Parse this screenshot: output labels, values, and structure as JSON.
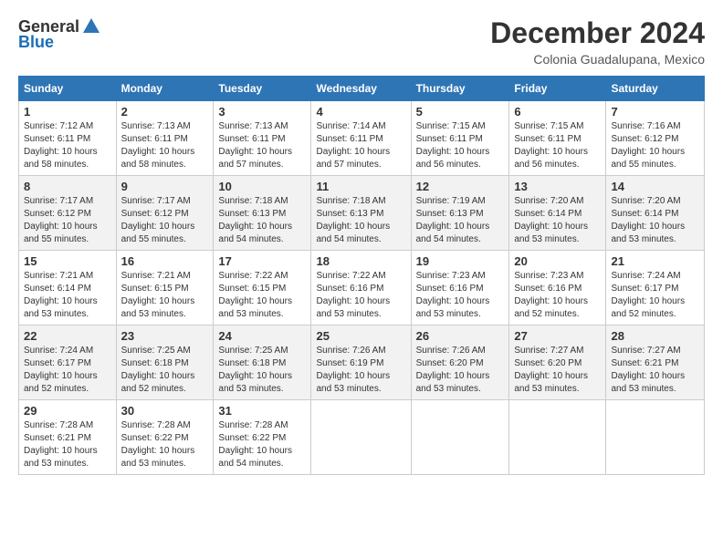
{
  "logo": {
    "general": "General",
    "blue": "Blue"
  },
  "title": "December 2024",
  "location": "Colonia Guadalupana, Mexico",
  "columns": [
    "Sunday",
    "Monday",
    "Tuesday",
    "Wednesday",
    "Thursday",
    "Friday",
    "Saturday"
  ],
  "weeks": [
    [
      {
        "day": "1",
        "info": "Sunrise: 7:12 AM\nSunset: 6:11 PM\nDaylight: 10 hours\nand 58 minutes."
      },
      {
        "day": "2",
        "info": "Sunrise: 7:13 AM\nSunset: 6:11 PM\nDaylight: 10 hours\nand 58 minutes."
      },
      {
        "day": "3",
        "info": "Sunrise: 7:13 AM\nSunset: 6:11 PM\nDaylight: 10 hours\nand 57 minutes."
      },
      {
        "day": "4",
        "info": "Sunrise: 7:14 AM\nSunset: 6:11 PM\nDaylight: 10 hours\nand 57 minutes."
      },
      {
        "day": "5",
        "info": "Sunrise: 7:15 AM\nSunset: 6:11 PM\nDaylight: 10 hours\nand 56 minutes."
      },
      {
        "day": "6",
        "info": "Sunrise: 7:15 AM\nSunset: 6:11 PM\nDaylight: 10 hours\nand 56 minutes."
      },
      {
        "day": "7",
        "info": "Sunrise: 7:16 AM\nSunset: 6:12 PM\nDaylight: 10 hours\nand 55 minutes."
      }
    ],
    [
      {
        "day": "8",
        "info": "Sunrise: 7:17 AM\nSunset: 6:12 PM\nDaylight: 10 hours\nand 55 minutes."
      },
      {
        "day": "9",
        "info": "Sunrise: 7:17 AM\nSunset: 6:12 PM\nDaylight: 10 hours\nand 55 minutes."
      },
      {
        "day": "10",
        "info": "Sunrise: 7:18 AM\nSunset: 6:13 PM\nDaylight: 10 hours\nand 54 minutes."
      },
      {
        "day": "11",
        "info": "Sunrise: 7:18 AM\nSunset: 6:13 PM\nDaylight: 10 hours\nand 54 minutes."
      },
      {
        "day": "12",
        "info": "Sunrise: 7:19 AM\nSunset: 6:13 PM\nDaylight: 10 hours\nand 54 minutes."
      },
      {
        "day": "13",
        "info": "Sunrise: 7:20 AM\nSunset: 6:14 PM\nDaylight: 10 hours\nand 53 minutes."
      },
      {
        "day": "14",
        "info": "Sunrise: 7:20 AM\nSunset: 6:14 PM\nDaylight: 10 hours\nand 53 minutes."
      }
    ],
    [
      {
        "day": "15",
        "info": "Sunrise: 7:21 AM\nSunset: 6:14 PM\nDaylight: 10 hours\nand 53 minutes."
      },
      {
        "day": "16",
        "info": "Sunrise: 7:21 AM\nSunset: 6:15 PM\nDaylight: 10 hours\nand 53 minutes."
      },
      {
        "day": "17",
        "info": "Sunrise: 7:22 AM\nSunset: 6:15 PM\nDaylight: 10 hours\nand 53 minutes."
      },
      {
        "day": "18",
        "info": "Sunrise: 7:22 AM\nSunset: 6:16 PM\nDaylight: 10 hours\nand 53 minutes."
      },
      {
        "day": "19",
        "info": "Sunrise: 7:23 AM\nSunset: 6:16 PM\nDaylight: 10 hours\nand 53 minutes."
      },
      {
        "day": "20",
        "info": "Sunrise: 7:23 AM\nSunset: 6:16 PM\nDaylight: 10 hours\nand 52 minutes."
      },
      {
        "day": "21",
        "info": "Sunrise: 7:24 AM\nSunset: 6:17 PM\nDaylight: 10 hours\nand 52 minutes."
      }
    ],
    [
      {
        "day": "22",
        "info": "Sunrise: 7:24 AM\nSunset: 6:17 PM\nDaylight: 10 hours\nand 52 minutes."
      },
      {
        "day": "23",
        "info": "Sunrise: 7:25 AM\nSunset: 6:18 PM\nDaylight: 10 hours\nand 52 minutes."
      },
      {
        "day": "24",
        "info": "Sunrise: 7:25 AM\nSunset: 6:18 PM\nDaylight: 10 hours\nand 53 minutes."
      },
      {
        "day": "25",
        "info": "Sunrise: 7:26 AM\nSunset: 6:19 PM\nDaylight: 10 hours\nand 53 minutes."
      },
      {
        "day": "26",
        "info": "Sunrise: 7:26 AM\nSunset: 6:20 PM\nDaylight: 10 hours\nand 53 minutes."
      },
      {
        "day": "27",
        "info": "Sunrise: 7:27 AM\nSunset: 6:20 PM\nDaylight: 10 hours\nand 53 minutes."
      },
      {
        "day": "28",
        "info": "Sunrise: 7:27 AM\nSunset: 6:21 PM\nDaylight: 10 hours\nand 53 minutes."
      }
    ],
    [
      {
        "day": "29",
        "info": "Sunrise: 7:28 AM\nSunset: 6:21 PM\nDaylight: 10 hours\nand 53 minutes."
      },
      {
        "day": "30",
        "info": "Sunrise: 7:28 AM\nSunset: 6:22 PM\nDaylight: 10 hours\nand 53 minutes."
      },
      {
        "day": "31",
        "info": "Sunrise: 7:28 AM\nSunset: 6:22 PM\nDaylight: 10 hours\nand 54 minutes."
      },
      {
        "day": "",
        "info": ""
      },
      {
        "day": "",
        "info": ""
      },
      {
        "day": "",
        "info": ""
      },
      {
        "day": "",
        "info": ""
      }
    ]
  ]
}
